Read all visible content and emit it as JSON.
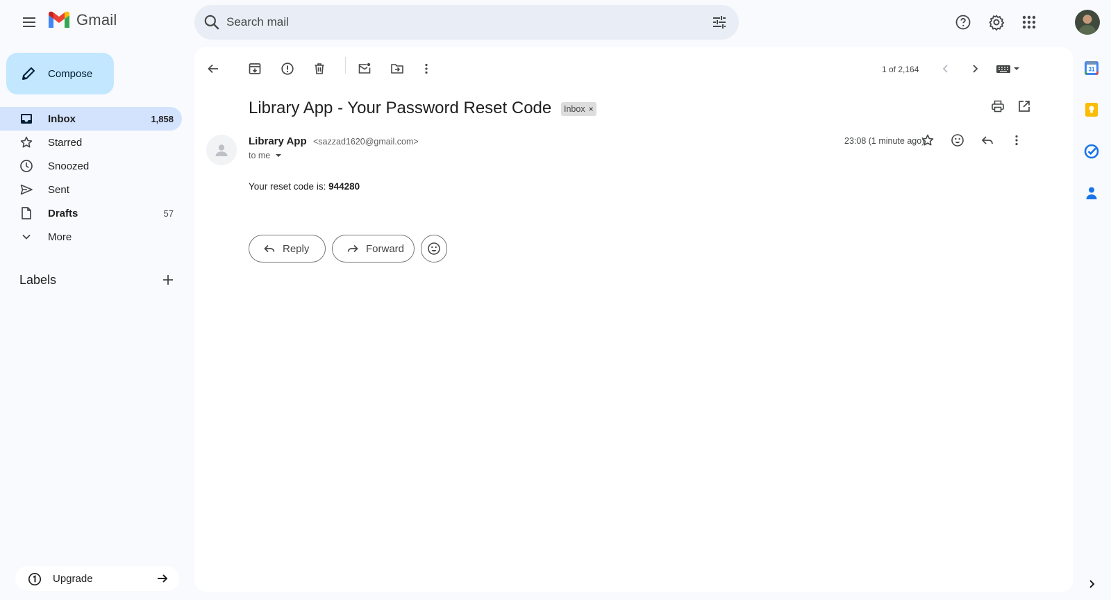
{
  "app": {
    "name": "Gmail"
  },
  "search": {
    "placeholder": "Search mail"
  },
  "compose": {
    "label": "Compose"
  },
  "sidebar": {
    "items": [
      {
        "label": "Inbox",
        "count": "1,858",
        "active": true,
        "icon": "inbox-icon"
      },
      {
        "label": "Starred",
        "count": "",
        "icon": "star-icon"
      },
      {
        "label": "Snoozed",
        "count": "",
        "icon": "clock-icon"
      },
      {
        "label": "Sent",
        "count": "",
        "icon": "send-icon"
      },
      {
        "label": "Drafts",
        "count": "57",
        "icon": "draft-icon"
      },
      {
        "label": "More",
        "count": "",
        "icon": "chevron-down-icon"
      }
    ],
    "labels_title": "Labels",
    "upgrade_label": "Upgrade"
  },
  "toolbar": {
    "pager": "1 of 2,164"
  },
  "email": {
    "subject": "Library App - Your Password Reset Code",
    "badge": "Inbox",
    "badge_remove": "×",
    "sender_name": "Library App",
    "sender_email": "<sazzad1620@gmail.com>",
    "to": "to me",
    "time": "23:08 (1 minute ago)",
    "body_prefix": "Your reset code is: ",
    "code": "944280"
  },
  "actions": {
    "reply": "Reply",
    "forward": "Forward"
  },
  "colors": {
    "compose_bg": "#c2e7ff",
    "active_nav": "#d3e3fd",
    "search_bg": "#e9eef6",
    "page_bg": "#f8fafd"
  }
}
